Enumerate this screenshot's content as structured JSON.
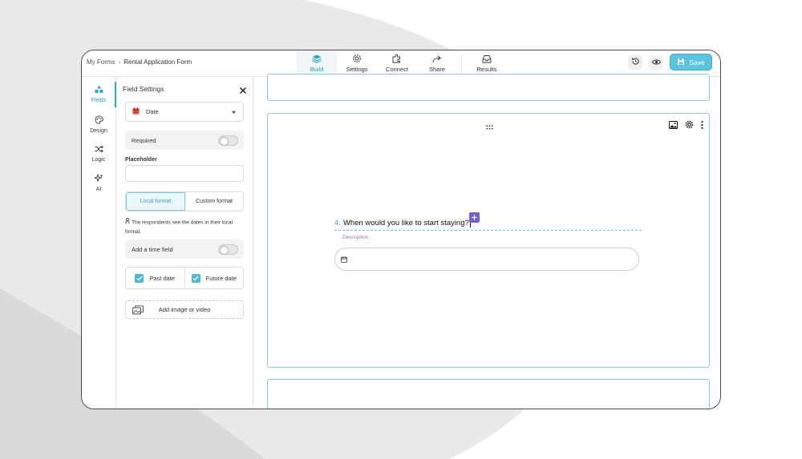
{
  "breadcrumb": {
    "root": "My Forms",
    "separator": "›",
    "current": "Rental Application Form"
  },
  "nav": {
    "tabs": [
      {
        "label": "Build",
        "icon": "layers-icon",
        "active": true
      },
      {
        "label": "Settings",
        "icon": "gear-icon"
      },
      {
        "label": "Connect",
        "icon": "puzzle-icon"
      },
      {
        "label": "Share",
        "icon": "share-arrow-icon"
      },
      {
        "label": "Results",
        "icon": "inbox-icon"
      }
    ]
  },
  "actions": {
    "history_icon": "history-icon",
    "preview_icon": "eye-icon",
    "save_label": "Save"
  },
  "rail": {
    "items": [
      {
        "label": "Fields",
        "icon": "fields-icon",
        "active": true
      },
      {
        "label": "Design",
        "icon": "palette-icon"
      },
      {
        "label": "Logic",
        "icon": "shuffle-icon"
      },
      {
        "label": "AI",
        "icon": "sparkle-icon"
      }
    ]
  },
  "panel": {
    "title": "Field Settings",
    "field_type": "Date",
    "required_label": "Required",
    "required_on": false,
    "placeholder_label": "Placeholder",
    "placeholder_value": "",
    "format": {
      "local": "Local format",
      "custom": "Custom format",
      "selected": "local"
    },
    "format_note": "The respondents see the dates in their local format.",
    "time_field_label": "Add a time field",
    "time_field_on": false,
    "past_date_label": "Past date",
    "past_date_checked": true,
    "future_date_label": "Future date",
    "future_date_checked": true,
    "add_media_label": "Add image or video"
  },
  "question": {
    "number": "4.",
    "text": "When would you like to start staying?",
    "description_placeholder": "Description"
  },
  "colors": {
    "accent": "#2aa6c6",
    "save_bg": "#5cc4dc",
    "ai_purple": "#7b5ad6",
    "date_red": "#e0443e"
  }
}
